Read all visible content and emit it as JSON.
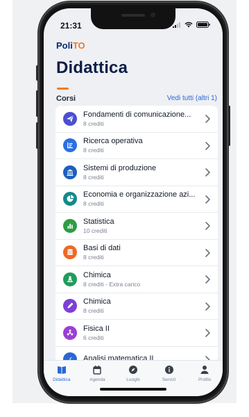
{
  "status": {
    "time": "21:31"
  },
  "brand": {
    "poli": "Poli",
    "to": "TO"
  },
  "page": {
    "title": "Didattica"
  },
  "section": {
    "label": "Corsi",
    "see_all": "Vedi tutti (altri 1)"
  },
  "courses": [
    {
      "name": "Fondamenti di comunicazione...",
      "sub": "8 crediti",
      "color": "#4b4fd1",
      "icon": "paper-plane-icon"
    },
    {
      "name": "Ricerca operativa",
      "sub": "8 crediti",
      "color": "#2a6fe0",
      "icon": "chart-list-icon"
    },
    {
      "name": "Sistemi di produzione",
      "sub": "8 crediti",
      "color": "#1c5fbf",
      "icon": "building-icon"
    },
    {
      "name": "Economia e organizzazione azi...",
      "sub": "8 crediti",
      "color": "#128a8a",
      "icon": "pie-chart-icon"
    },
    {
      "name": "Statistica",
      "sub": "10 crediti",
      "color": "#2e9d45",
      "icon": "bar-chart-icon"
    },
    {
      "name": "Basi di dati",
      "sub": "8 crediti",
      "color": "#ee6a24",
      "icon": "database-icon"
    },
    {
      "name": "Chimica",
      "sub": "8 crediti - Extra carico",
      "color": "#1f9d5a",
      "icon": "flask-icon"
    },
    {
      "name": "Chimica",
      "sub": "8 crediti",
      "color": "#7d3fd6",
      "icon": "pencil-icon"
    },
    {
      "name": "Fisica II",
      "sub": "6 crediti",
      "color": "#9a3fd4",
      "icon": "atom-icon"
    },
    {
      "name": "Analisi matematica II",
      "sub": "",
      "color": "#2a67d6",
      "icon": "function-icon"
    }
  ],
  "tabs": [
    {
      "label": "Didattica",
      "icon": "book-icon",
      "active": true
    },
    {
      "label": "Agenda",
      "icon": "calendar-icon",
      "active": false
    },
    {
      "label": "Luoghi",
      "icon": "compass-icon",
      "active": false
    },
    {
      "label": "Servizi",
      "icon": "info-icon",
      "active": false
    },
    {
      "label": "Profilo",
      "icon": "user-icon",
      "active": false
    }
  ],
  "colors": {
    "accent": "#2a67d6",
    "brand_orange": "#ef7b22",
    "title": "#0b1e47"
  }
}
